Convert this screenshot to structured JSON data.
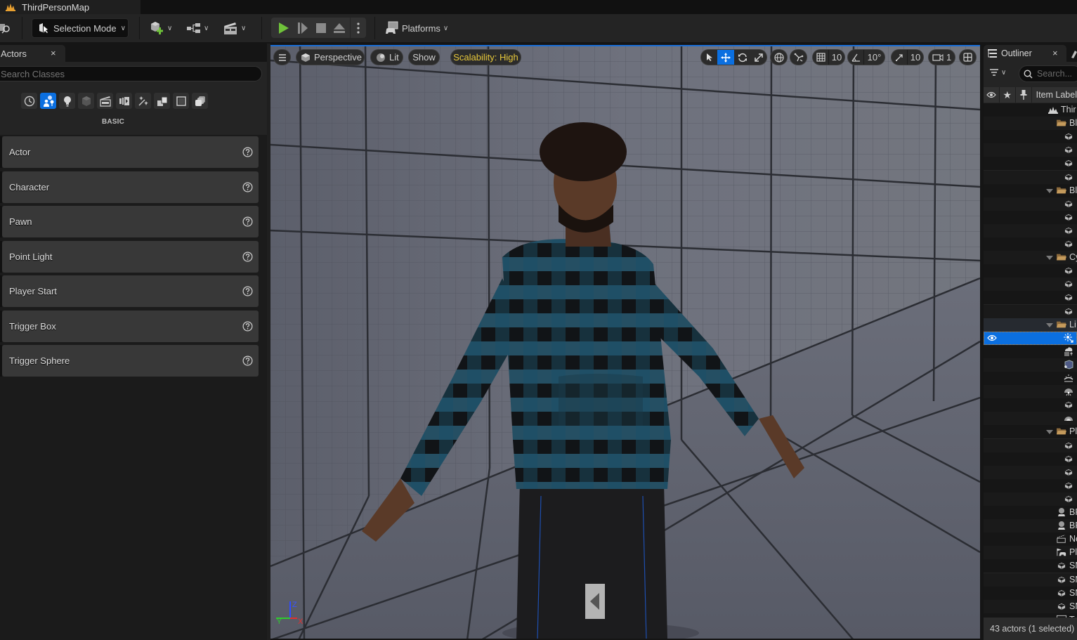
{
  "window": {
    "map_tab_title": "ThirdPersonMap"
  },
  "toolbar": {
    "selection_mode_label": "Selection Mode",
    "platforms_label": "Platforms",
    "play_controls": [
      "play",
      "advance-frame",
      "stop",
      "eject"
    ]
  },
  "actors_panel": {
    "tab_label": "Actors",
    "close_glyph": "×",
    "search_placeholder": "Search Classes",
    "search_visible_text": "ch Classes",
    "categories": [
      {
        "name": "recently-placed",
        "active": false
      },
      {
        "name": "basic",
        "active": true
      },
      {
        "name": "lights",
        "active": false
      },
      {
        "name": "shapes",
        "active": false
      },
      {
        "name": "cinematic",
        "active": false
      },
      {
        "name": "visual-effects",
        "active": false
      },
      {
        "name": "effects",
        "active": false
      },
      {
        "name": "geometry",
        "active": false
      },
      {
        "name": "volumes",
        "active": false
      },
      {
        "name": "all-classes",
        "active": false
      }
    ],
    "section_title": "BASIC",
    "items": [
      {
        "label": "Actor"
      },
      {
        "label": "Character"
      },
      {
        "label": "Pawn"
      },
      {
        "label": "Point Light"
      },
      {
        "label": "Player Start"
      },
      {
        "label": "Trigger Box"
      },
      {
        "label": "Trigger Sphere"
      }
    ]
  },
  "viewport": {
    "menu_icon": "hamburger-icon",
    "view_mode": "Perspective",
    "lighting_mode": "Lit",
    "show_label": "Show",
    "scalability_label": "Scalability: High",
    "transform_tools": [
      {
        "name": "select",
        "active": false
      },
      {
        "name": "translate",
        "active": true
      },
      {
        "name": "rotate",
        "active": false
      },
      {
        "name": "scale",
        "active": false
      }
    ],
    "grid_snap_value": "10",
    "rotation_snap_value": "10°",
    "scale_snap_value": "10",
    "camera_speed_value": "1",
    "axis_labels": {
      "x": "X",
      "y": "Y",
      "z": "Z"
    },
    "accent_color": "#0b6fe0",
    "scalability_color": "#e8c93b"
  },
  "outliner": {
    "tab_label": "Outliner",
    "close_glyph": "×",
    "search_placeholder": "Search...",
    "header_item_label": "Item Label",
    "rows": [
      {
        "type": "map",
        "label": "Thir"
      },
      {
        "type": "folder",
        "label": "Bl",
        "expanded": false
      },
      {
        "type": "mesh",
        "label": ""
      },
      {
        "type": "mesh",
        "label": ""
      },
      {
        "type": "mesh",
        "label": ""
      },
      {
        "type": "mesh",
        "label": ""
      },
      {
        "type": "folder",
        "label": "Bl",
        "expanded": true
      },
      {
        "type": "mesh",
        "label": ""
      },
      {
        "type": "mesh",
        "label": ""
      },
      {
        "type": "mesh",
        "label": ""
      },
      {
        "type": "mesh",
        "label": ""
      },
      {
        "type": "folder",
        "label": "Cy",
        "expanded": true
      },
      {
        "type": "mesh",
        "label": ""
      },
      {
        "type": "mesh",
        "label": ""
      },
      {
        "type": "mesh",
        "label": ""
      },
      {
        "type": "mesh",
        "label": ""
      },
      {
        "type": "folder",
        "label": "Li",
        "expanded": true
      },
      {
        "type": "directional-light",
        "label": "",
        "selected": true
      },
      {
        "type": "sky-atmosphere",
        "label": ""
      },
      {
        "type": "post-process",
        "label": ""
      },
      {
        "type": "sky-light",
        "label": ""
      },
      {
        "type": "fog",
        "label": ""
      },
      {
        "type": "mesh",
        "label": ""
      },
      {
        "type": "sky-dome",
        "label": ""
      },
      {
        "type": "folder",
        "label": "Pl",
        "expanded": true
      },
      {
        "type": "mesh",
        "label": ""
      },
      {
        "type": "mesh",
        "label": ""
      },
      {
        "type": "mesh",
        "label": ""
      },
      {
        "type": "mesh",
        "label": ""
      },
      {
        "type": "mesh",
        "label": ""
      },
      {
        "type": "pawn",
        "label": "BF"
      },
      {
        "type": "pawn",
        "label": "BF"
      },
      {
        "type": "level-sequence",
        "label": "Ne"
      },
      {
        "type": "player-start",
        "label": "Pl"
      },
      {
        "type": "mesh",
        "label": "SM"
      },
      {
        "type": "mesh",
        "label": "SM"
      },
      {
        "type": "mesh",
        "label": "SM"
      },
      {
        "type": "mesh",
        "label": "SM"
      },
      {
        "type": "text-render",
        "label": "Te"
      }
    ],
    "status": "43 actors (1 selected)"
  }
}
